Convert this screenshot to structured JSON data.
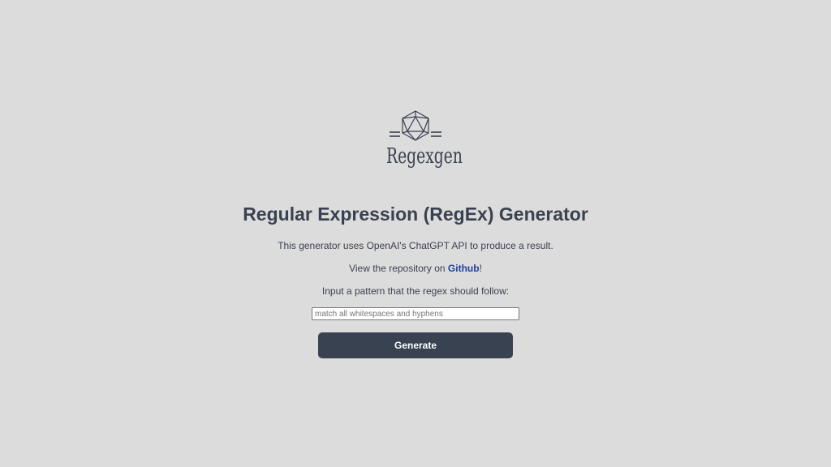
{
  "logo": {
    "icon": "icosahedron-icon",
    "wordmark": "Regexgen"
  },
  "main": {
    "title": "Regular Expression (RegEx) Generator",
    "description": "This generator uses OpenAI's ChatGPT API to produce a result.",
    "repo_prefix": "View the repository on ",
    "repo_link": "Github",
    "repo_suffix": "!",
    "instruction": "Input a pattern that the regex should follow:",
    "input_placeholder": "match all whitespaces and hyphens",
    "input_value": "",
    "button_label": "Generate"
  },
  "colors": {
    "background": "#dcdcdc",
    "text": "#3a4150",
    "link": "#1f3f9e",
    "button": "#394250"
  }
}
